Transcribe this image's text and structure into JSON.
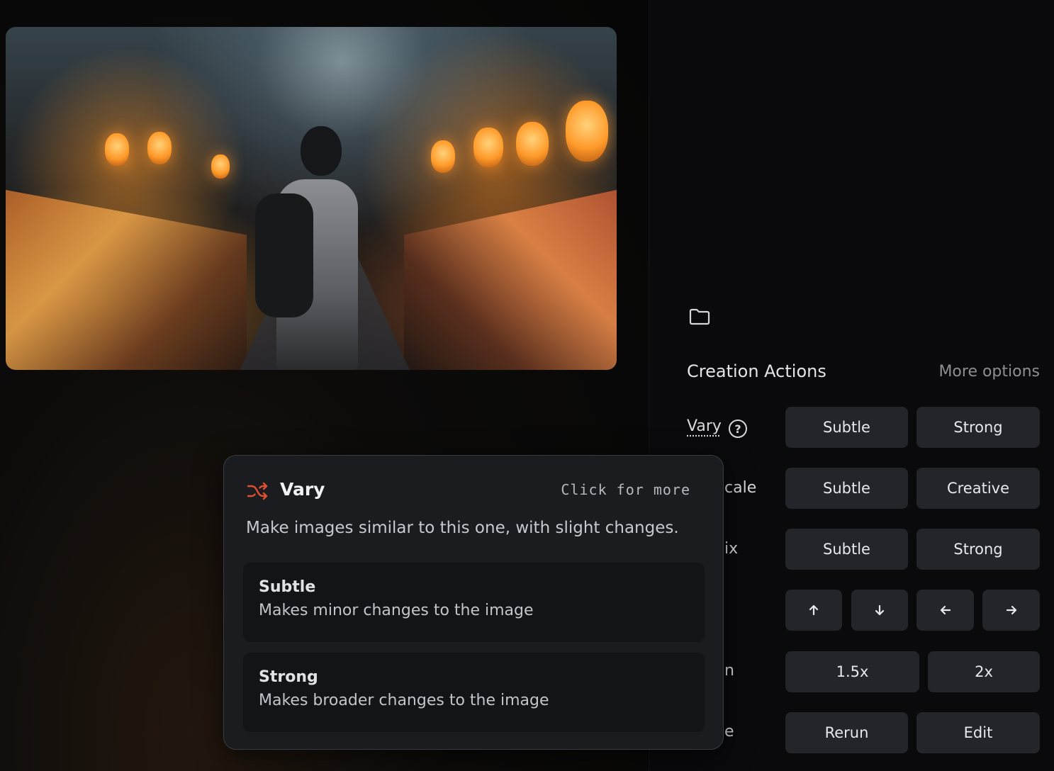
{
  "image": {
    "alt_icon": "photo-night-market"
  },
  "panel": {
    "section_title": "Creation Actions",
    "more_options": "More options",
    "rows": [
      {
        "label": "Vary",
        "buttons": [
          "Subtle",
          "Strong"
        ]
      },
      {
        "label": "cale",
        "buttons": [
          "Subtle",
          "Creative"
        ]
      },
      {
        "label": "ix",
        "buttons": [
          "Subtle",
          "Strong"
        ]
      },
      {
        "label": "",
        "buttons": [
          "arrow-up",
          "arrow-down",
          "arrow-left",
          "arrow-right"
        ]
      },
      {
        "label": "n",
        "buttons": [
          "1.5x",
          "2x"
        ]
      },
      {
        "label": "e",
        "buttons": [
          "Rerun",
          "Edit"
        ]
      }
    ]
  },
  "popover": {
    "icon": "shuffle-icon",
    "title": "Vary",
    "hint": "Click for more",
    "description": "Make images similar to this one, with slight changes.",
    "options": [
      {
        "title": "Subtle",
        "description": "Makes minor changes to the image"
      },
      {
        "title": "Strong",
        "description": "Makes broader changes to the image"
      }
    ]
  },
  "colors": {
    "accent": "#e0502e",
    "button_bg": "#23252b",
    "popover_bg": "#1b1c20"
  }
}
